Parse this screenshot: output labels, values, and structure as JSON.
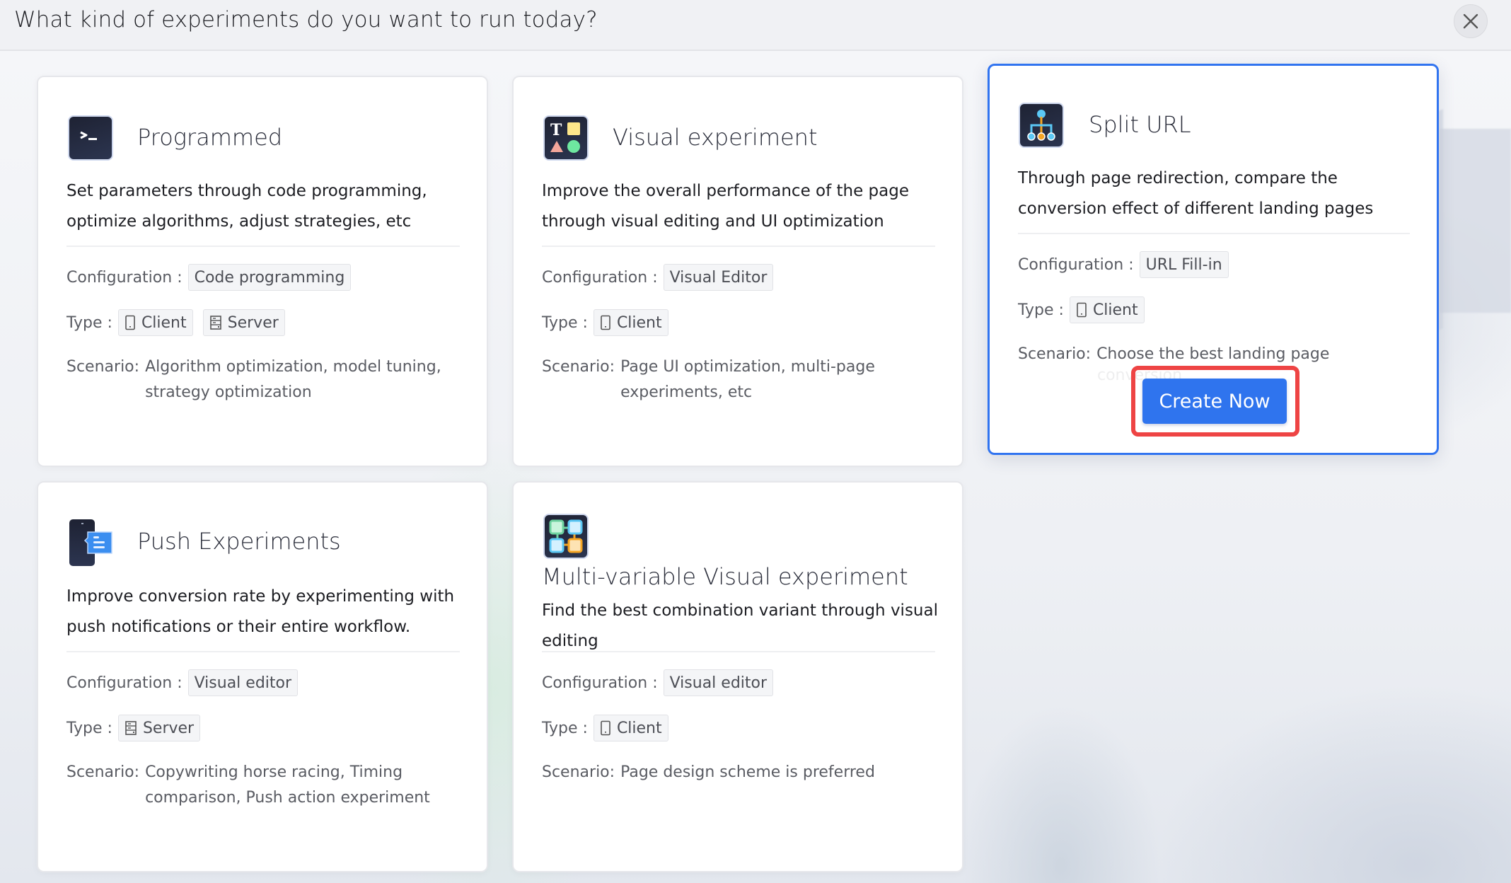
{
  "header": {
    "title": "What kind of experiments do you want to run today?",
    "close_icon": "close-icon"
  },
  "labels": {
    "configuration": "Configuration :",
    "type": "Type :",
    "scenario": "Scenario:"
  },
  "cards": [
    {
      "id": "programmed",
      "icon": "terminal-icon",
      "title": "Programmed",
      "description": "Set parameters through code programming, optimize algorithms, adjust strategies, etc",
      "configuration": "Code programming",
      "types": [
        {
          "label": "Client",
          "icon": "mobile-icon"
        },
        {
          "label": "Server",
          "icon": "server-icon"
        }
      ],
      "scenario": "Algorithm optimization, model tuning, strategy optimization",
      "selected": false
    },
    {
      "id": "visual",
      "icon": "shapes-icon",
      "title": "Visual experiment",
      "description": "Improve the overall performance of the page through visual editing and UI optimization",
      "configuration": "Visual Editor",
      "types": [
        {
          "label": "Client",
          "icon": "mobile-icon"
        }
      ],
      "scenario": "Page UI optimization, multi-page experiments, etc",
      "selected": false
    },
    {
      "id": "split-url",
      "icon": "split-tree-icon",
      "title": "Split URL",
      "description": "Through page redirection, compare the conversion effect of different landing pages",
      "configuration": "URL Fill-in",
      "types": [
        {
          "label": "Client",
          "icon": "mobile-icon"
        }
      ],
      "scenario": "Choose the best landing page",
      "scenario_hidden_tail": "conversion",
      "selected": true,
      "action_label": "Create Now"
    },
    {
      "id": "push",
      "icon": "push-notification-icon",
      "title": "Push Experiments",
      "description": "Improve conversion rate by experimenting with push notifications or their entire workflow.",
      "configuration": "Visual editor",
      "types": [
        {
          "label": "Server",
          "icon": "server-icon"
        }
      ],
      "scenario": "Copywriting horse racing, Timing comparison, Push action experiment",
      "selected": false
    },
    {
      "id": "multi-variable",
      "icon": "multi-variable-grid-icon",
      "title": "Multi-variable Visual experiment",
      "description": "Find the best combination variant through visual editing",
      "configuration": "Visual editor",
      "types": [
        {
          "label": "Client",
          "icon": "mobile-icon"
        }
      ],
      "scenario": "Page design scheme is preferred",
      "selected": false
    }
  ],
  "colors": {
    "accent": "#2f74ee",
    "selected_border": "#3174f0",
    "highlight_red": "#ee4444",
    "icon_bg": "#1e2233"
  }
}
